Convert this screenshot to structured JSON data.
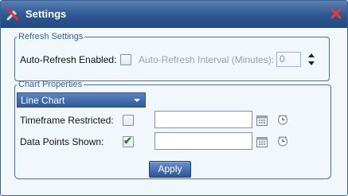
{
  "dialog": {
    "title": "Settings",
    "accent_color": "#2e5690"
  },
  "refresh_settings": {
    "legend": "Refresh Settings",
    "auto_refresh_label": "Auto-Refresh Enabled:",
    "auto_refresh_checked": false,
    "interval_label": "Auto-Refresh Interval (Minutes):",
    "interval_value": "0"
  },
  "chart_properties": {
    "legend": "Chart Properties",
    "chart_type_selected": "Line Chart",
    "timeframe_label": "Timeframe Restricted:",
    "timeframe_checked": false,
    "timeframe_value": "",
    "datapoints_label": "Data Points Shown:",
    "datapoints_checked": true,
    "datapoints_value": ""
  },
  "buttons": {
    "apply_label": "Apply"
  },
  "icons": {
    "title": "tools-icon",
    "close": "close-icon",
    "spinner": "up-down-arrows-icon",
    "calendar": "calendar-icon",
    "clock": "clock-icon",
    "check": "✔"
  }
}
